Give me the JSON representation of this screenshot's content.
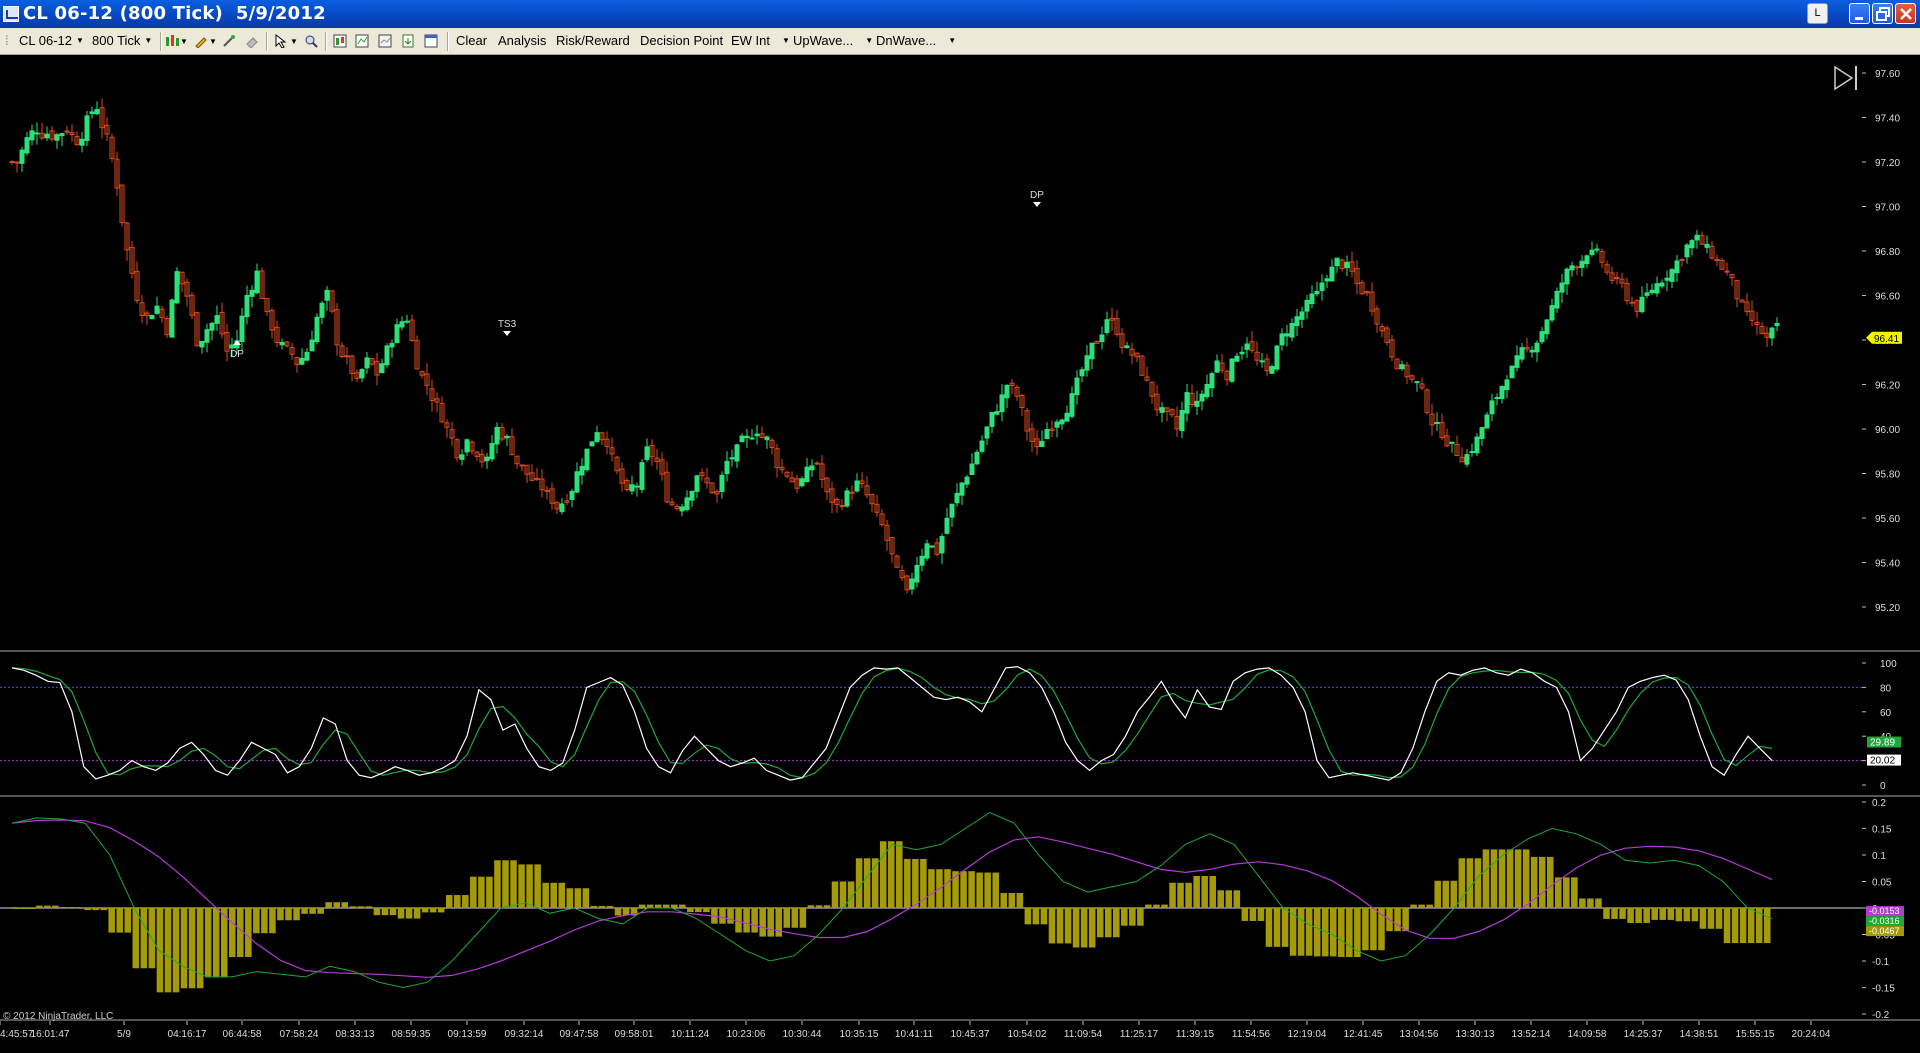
{
  "window": {
    "title": "CL 06-12 (800 Tick)  5/9/2012",
    "l_button": "L"
  },
  "toolbar": {
    "instrument": "CL 06-12",
    "interval": "800 Tick",
    "clear": "Clear",
    "analysis": "Analysis",
    "risk_reward": "Risk/Reward",
    "decision_point": "Decision Point",
    "ew_int": "EW Int",
    "upwave": "UpWave...",
    "dnwave": "DnWave..."
  },
  "copyright": "© 2012 NinjaTrader, LLC",
  "colors": {
    "up_candle": "#2ee07a",
    "down_candle": "#d84a1e",
    "stoch_k": "#ffffff",
    "stoch_d": "#1fa83a",
    "macd_hist": "#a59a0a",
    "macd_line": "#1fa83a",
    "signal_line": "#b53ad8",
    "level_high": "#3a54d8",
    "level_low": "#a93ad8"
  },
  "chart_data": [
    {
      "type": "candlestick",
      "ylim": [
        95.1,
        97.65
      ],
      "yticks": [
        "97.60",
        "97.40",
        "97.20",
        "97.00",
        "96.80",
        "96.60",
        "96.40",
        "96.20",
        "96.00",
        "95.80",
        "95.60",
        "95.40",
        "95.20"
      ],
      "last_price": "96.41",
      "annotations": [
        {
          "text": "DP",
          "x_index": 45
        },
        {
          "text": "TS3",
          "x_index": 99
        },
        {
          "text": "DP",
          "x_index": 205
        }
      ],
      "xticks": [
        "4:45:57",
        "16:01:47",
        "5/9",
        "04:16:17",
        "06:44:58",
        "07:58:24",
        "08:33:13",
        "08:59:35",
        "09:13:59",
        "09:32:14",
        "09:47:58",
        "09:58:01",
        "10:11:24",
        "10:23:06",
        "10:30:44",
        "10:35:15",
        "10:41:11",
        "10:45:37",
        "10:54:02",
        "11:09:54",
        "11:25:17",
        "11:39:15",
        "11:54:56",
        "12:19:04",
        "12:41:45",
        "13:04:56",
        "13:30:13",
        "13:52:14",
        "14:09:58",
        "14:25:37",
        "14:38:51",
        "15:55:15",
        "20:24:04"
      ],
      "close_path": [
        97.2,
        97.3,
        97.35,
        97.33,
        97.32,
        97.35,
        97.3,
        97.38,
        97.45,
        97.3,
        97.1,
        96.8,
        96.6,
        96.5,
        96.55,
        96.45,
        96.7,
        96.6,
        96.4,
        96.45,
        96.5,
        96.35,
        96.4,
        96.6,
        96.7,
        96.5,
        96.4,
        96.35,
        96.3,
        96.35,
        96.5,
        96.6,
        96.4,
        96.3,
        96.2,
        96.3,
        96.25,
        96.35,
        96.45,
        96.5,
        96.3,
        96.2,
        96.1,
        96.0,
        95.9,
        95.95,
        95.9,
        95.85,
        96.0,
        95.95,
        95.85,
        95.8,
        95.75,
        95.7,
        95.65,
        95.7,
        95.8,
        95.9,
        96.0,
        95.95,
        95.8,
        95.7,
        95.75,
        95.9,
        95.85,
        95.7,
        95.65,
        95.7,
        95.8,
        95.75,
        95.7,
        95.85,
        95.9,
        95.95,
        96.0,
        95.95,
        95.85,
        95.8,
        95.75,
        95.8,
        95.85,
        95.7,
        95.65,
        95.7,
        95.75,
        95.7,
        95.6,
        95.5,
        95.35,
        95.25,
        95.4,
        95.5,
        95.45,
        95.6,
        95.7,
        95.8,
        95.9,
        96.0,
        96.1,
        96.2,
        96.15,
        96.0,
        95.9,
        96.0,
        96.05,
        96.1,
        96.2,
        96.3,
        96.4,
        96.5,
        96.45,
        96.35,
        96.3,
        96.2,
        96.1,
        96.05,
        96.0,
        96.15,
        96.1,
        96.2,
        96.3,
        96.25,
        96.35,
        96.4,
        96.3,
        96.25,
        96.35,
        96.45,
        96.5,
        96.55,
        96.6,
        96.7,
        96.75,
        96.72,
        96.65,
        96.6,
        96.5,
        96.4,
        96.3,
        96.25,
        96.2,
        96.1,
        96.0,
        95.95,
        95.9,
        95.88,
        95.95,
        96.05,
        96.15,
        96.25,
        96.3,
        96.35,
        96.4,
        96.5,
        96.6,
        96.7,
        96.75,
        96.8,
        96.78,
        96.7,
        96.65,
        96.6,
        96.55,
        96.6,
        96.65,
        96.7,
        96.75,
        96.82,
        96.85,
        96.8,
        96.75,
        96.7,
        96.6,
        96.5,
        96.45,
        96.4,
        96.45
      ]
    },
    {
      "type": "line",
      "name_hint": "oscillator",
      "ylim": [
        0,
        100
      ],
      "yticks": [
        "100",
        "80",
        "60",
        "40",
        "20",
        "0"
      ],
      "levels": [
        80,
        20
      ],
      "last_values": [
        "29.89",
        "20.02"
      ]
    },
    {
      "type": "bar+line",
      "name_hint": "histogram oscillator",
      "ylim": [
        -0.22,
        0.22
      ],
      "yticks": [
        "0.2",
        "0.15",
        "0.1",
        "0.05",
        "0",
        "-0.05",
        "-0.1",
        "-0.15",
        "-0.2"
      ],
      "last_values": [
        "-0.0153",
        "-0.0316",
        "-0.0467"
      ]
    }
  ]
}
